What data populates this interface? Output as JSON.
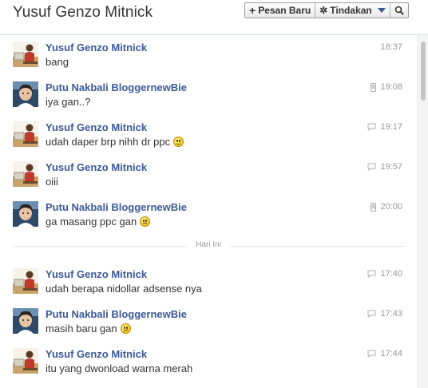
{
  "header": {
    "title": "Yusuf Genzo Mitnick",
    "new_message_label": "Pesan Baru",
    "actions_label": "Tindakan"
  },
  "colors": {
    "link": "#3b5998",
    "text": "#333333",
    "meta": "#999999"
  },
  "messages": [
    {
      "sender": "Yusuf Genzo Mitnick",
      "text": "bang",
      "time": "18:37",
      "via": "none",
      "emoticon": "none"
    },
    {
      "sender": "Putu Nakbali BloggernewBie",
      "text": "iya gan..?",
      "time": "19:08",
      "via": "mobile-icon",
      "emoticon": "none"
    },
    {
      "sender": "Yusuf Genzo Mitnick",
      "text": "udah daper brp nihh dr ppc",
      "time": "19:17",
      "via": "chat-bubble-icon",
      "emoticon": "smile"
    },
    {
      "sender": "Yusuf Genzo Mitnick",
      "text": "oiii",
      "time": "19:57",
      "via": "chat-bubble-icon",
      "emoticon": "none"
    },
    {
      "sender": "Putu Nakbali BloggernewBie",
      "text": "ga masang ppc gan",
      "time": "20:00",
      "via": "mobile-icon",
      "emoticon": "flat"
    }
  ],
  "day_separator": "Hari Ini",
  "messages_today": [
    {
      "sender": "Yusuf Genzo Mitnick",
      "text": "udah berapa nidollar adsense nya",
      "time": "17:40",
      "via": "chat-bubble-icon",
      "emoticon": "none"
    },
    {
      "sender": "Putu Nakbali BloggernewBie",
      "text": "masih baru gan",
      "time": "17:43",
      "via": "chat-bubble-icon",
      "emoticon": "sly"
    },
    {
      "sender": "Yusuf Genzo Mitnick",
      "text": "itu yang dwonload warna merah",
      "time": "17:44",
      "via": "chat-bubble-icon",
      "emoticon": "none"
    }
  ]
}
